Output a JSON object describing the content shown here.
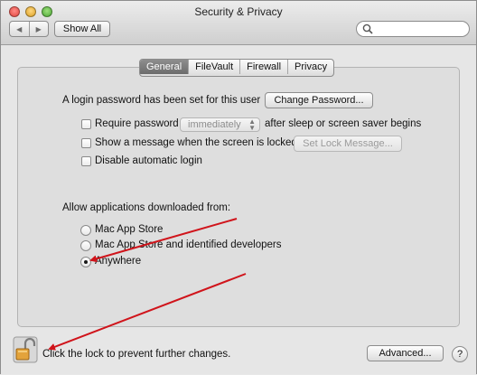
{
  "window": {
    "title": "Security & Privacy"
  },
  "toolbar": {
    "show_all": "Show All",
    "search_placeholder": ""
  },
  "tabs": [
    {
      "label": "General",
      "active": true
    },
    {
      "label": "FileVault",
      "active": false
    },
    {
      "label": "Firewall",
      "active": false
    },
    {
      "label": "Privacy",
      "active": false
    }
  ],
  "general": {
    "login_text": "A login password has been set for this user",
    "change_password": "Change Password...",
    "require_password_label": "Require password",
    "require_password_value": "immediately",
    "require_password_suffix": "after sleep or screen saver begins",
    "show_message_label": "Show a message when the screen is locked",
    "set_lock_message": "Set Lock Message...",
    "disable_auto_login": "Disable automatic login"
  },
  "downloads": {
    "heading": "Allow applications downloaded from:",
    "options": [
      {
        "label": "Mac App Store",
        "selected": false
      },
      {
        "label": "Mac App Store and identified developers",
        "selected": false
      },
      {
        "label": "Anywhere",
        "selected": true
      }
    ]
  },
  "footer": {
    "lock_text": "Click the lock to prevent further changes.",
    "advanced": "Advanced...",
    "help": "?"
  },
  "colors": {
    "annotation_arrow": "#d0141b",
    "active_tab": "#7a7a7a",
    "lock_body": "#e3a33b"
  },
  "icons": [
    "back-icon",
    "forward-icon",
    "search-icon",
    "lock-open-icon",
    "help-icon"
  ]
}
